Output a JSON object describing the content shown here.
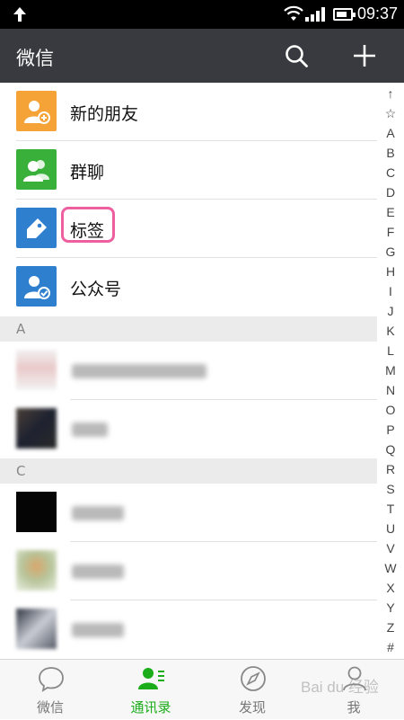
{
  "status_bar": {
    "time": "09:37",
    "battery_level": 0.8
  },
  "header": {
    "title": "微信"
  },
  "menu_items": [
    {
      "label": "新的朋友",
      "icon": "new-friend-icon",
      "color": "#f5a236"
    },
    {
      "label": "群聊",
      "icon": "group-chat-icon",
      "color": "#38b03a"
    },
    {
      "label": "标签",
      "icon": "tag-icon",
      "color": "#2f7fcf"
    },
    {
      "label": "公众号",
      "icon": "official-account-icon",
      "color": "#2f7fcf"
    }
  ],
  "sections": {
    "a": "A",
    "c": "C"
  },
  "alphabet_index": [
    "↑",
    "☆",
    "A",
    "B",
    "C",
    "D",
    "E",
    "F",
    "G",
    "H",
    "I",
    "J",
    "K",
    "L",
    "M",
    "N",
    "O",
    "P",
    "Q",
    "R",
    "S",
    "T",
    "U",
    "V",
    "W",
    "X",
    "Y",
    "Z",
    "#"
  ],
  "tabs": [
    {
      "label": "微信",
      "icon": "chat-bubble-icon"
    },
    {
      "label": "通讯录",
      "icon": "contacts-icon",
      "active": true
    },
    {
      "label": "发现",
      "icon": "compass-icon"
    },
    {
      "label": "我",
      "icon": "me-icon"
    }
  ],
  "watermark": "Bai du 经验",
  "colors": {
    "accent": "#1aad19",
    "header": "#393a3f",
    "highlight": "#ee5fa0"
  }
}
